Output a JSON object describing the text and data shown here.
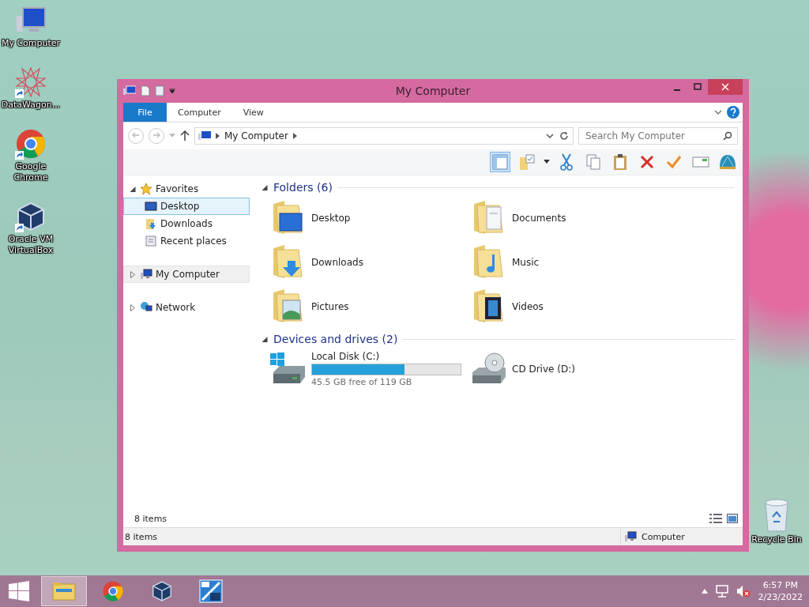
{
  "desktop_icons": [
    {
      "label": "My Computer",
      "kind": "computer"
    },
    {
      "label": "DataWagon...",
      "kind": "star"
    },
    {
      "label": "Google Chrome",
      "kind": "chrome"
    },
    {
      "label": "Oracle VM VirtualBox",
      "kind": "vbox"
    }
  ],
  "recycle_bin": {
    "label": "Recycle Bin"
  },
  "window": {
    "title": "My Computer",
    "ribbon_tabs": [
      {
        "label": "File",
        "selected": true
      },
      {
        "label": "Computer",
        "selected": false
      },
      {
        "label": "View",
        "selected": false
      }
    ],
    "address": {
      "crumbs": [
        "My Computer"
      ]
    },
    "search": {
      "placeholder": "Search My Computer"
    },
    "nav": [
      {
        "label": "Favorites",
        "kind": "favorites",
        "expanded": true,
        "selected": false,
        "children": [
          {
            "label": "Desktop",
            "kind": "desktop",
            "selected": true
          },
          {
            "label": "Downloads",
            "kind": "downloads",
            "selected": false
          },
          {
            "label": "Recent places",
            "kind": "recent",
            "selected": false
          }
        ]
      },
      {
        "label": "My Computer",
        "kind": "computer",
        "expanded": false,
        "selected": true
      },
      {
        "label": "Network",
        "kind": "network",
        "expanded": false,
        "selected": false
      }
    ],
    "sections": [
      {
        "title": "Folders (6)",
        "expanded": true,
        "items": [
          {
            "name": "Desktop",
            "kind": "desktop"
          },
          {
            "name": "Documents",
            "kind": "documents"
          },
          {
            "name": "Downloads",
            "kind": "downloads"
          },
          {
            "name": "Music",
            "kind": "music"
          },
          {
            "name": "Pictures",
            "kind": "pictures"
          },
          {
            "name": "Videos",
            "kind": "videos"
          }
        ]
      },
      {
        "title": "Devices and drives (2)",
        "expanded": true,
        "items": [
          {
            "name": "Local Disk (C:)",
            "kind": "disk",
            "level": 0.62,
            "detail": "45.5 GB free of 119 GB"
          },
          {
            "name": "CD Drive (D:)",
            "kind": "cd"
          }
        ]
      }
    ],
    "item_count": "8 items",
    "status": {
      "count": "8 items",
      "location": "Computer"
    }
  },
  "taskbar": {
    "apps": [
      {
        "kind": "explorer",
        "selected": true
      },
      {
        "kind": "chrome",
        "selected": false
      },
      {
        "kind": "vbox",
        "selected": false
      },
      {
        "kind": "app",
        "selected": false
      }
    ],
    "time": "6:57 PM",
    "date": "2/23/2022"
  }
}
